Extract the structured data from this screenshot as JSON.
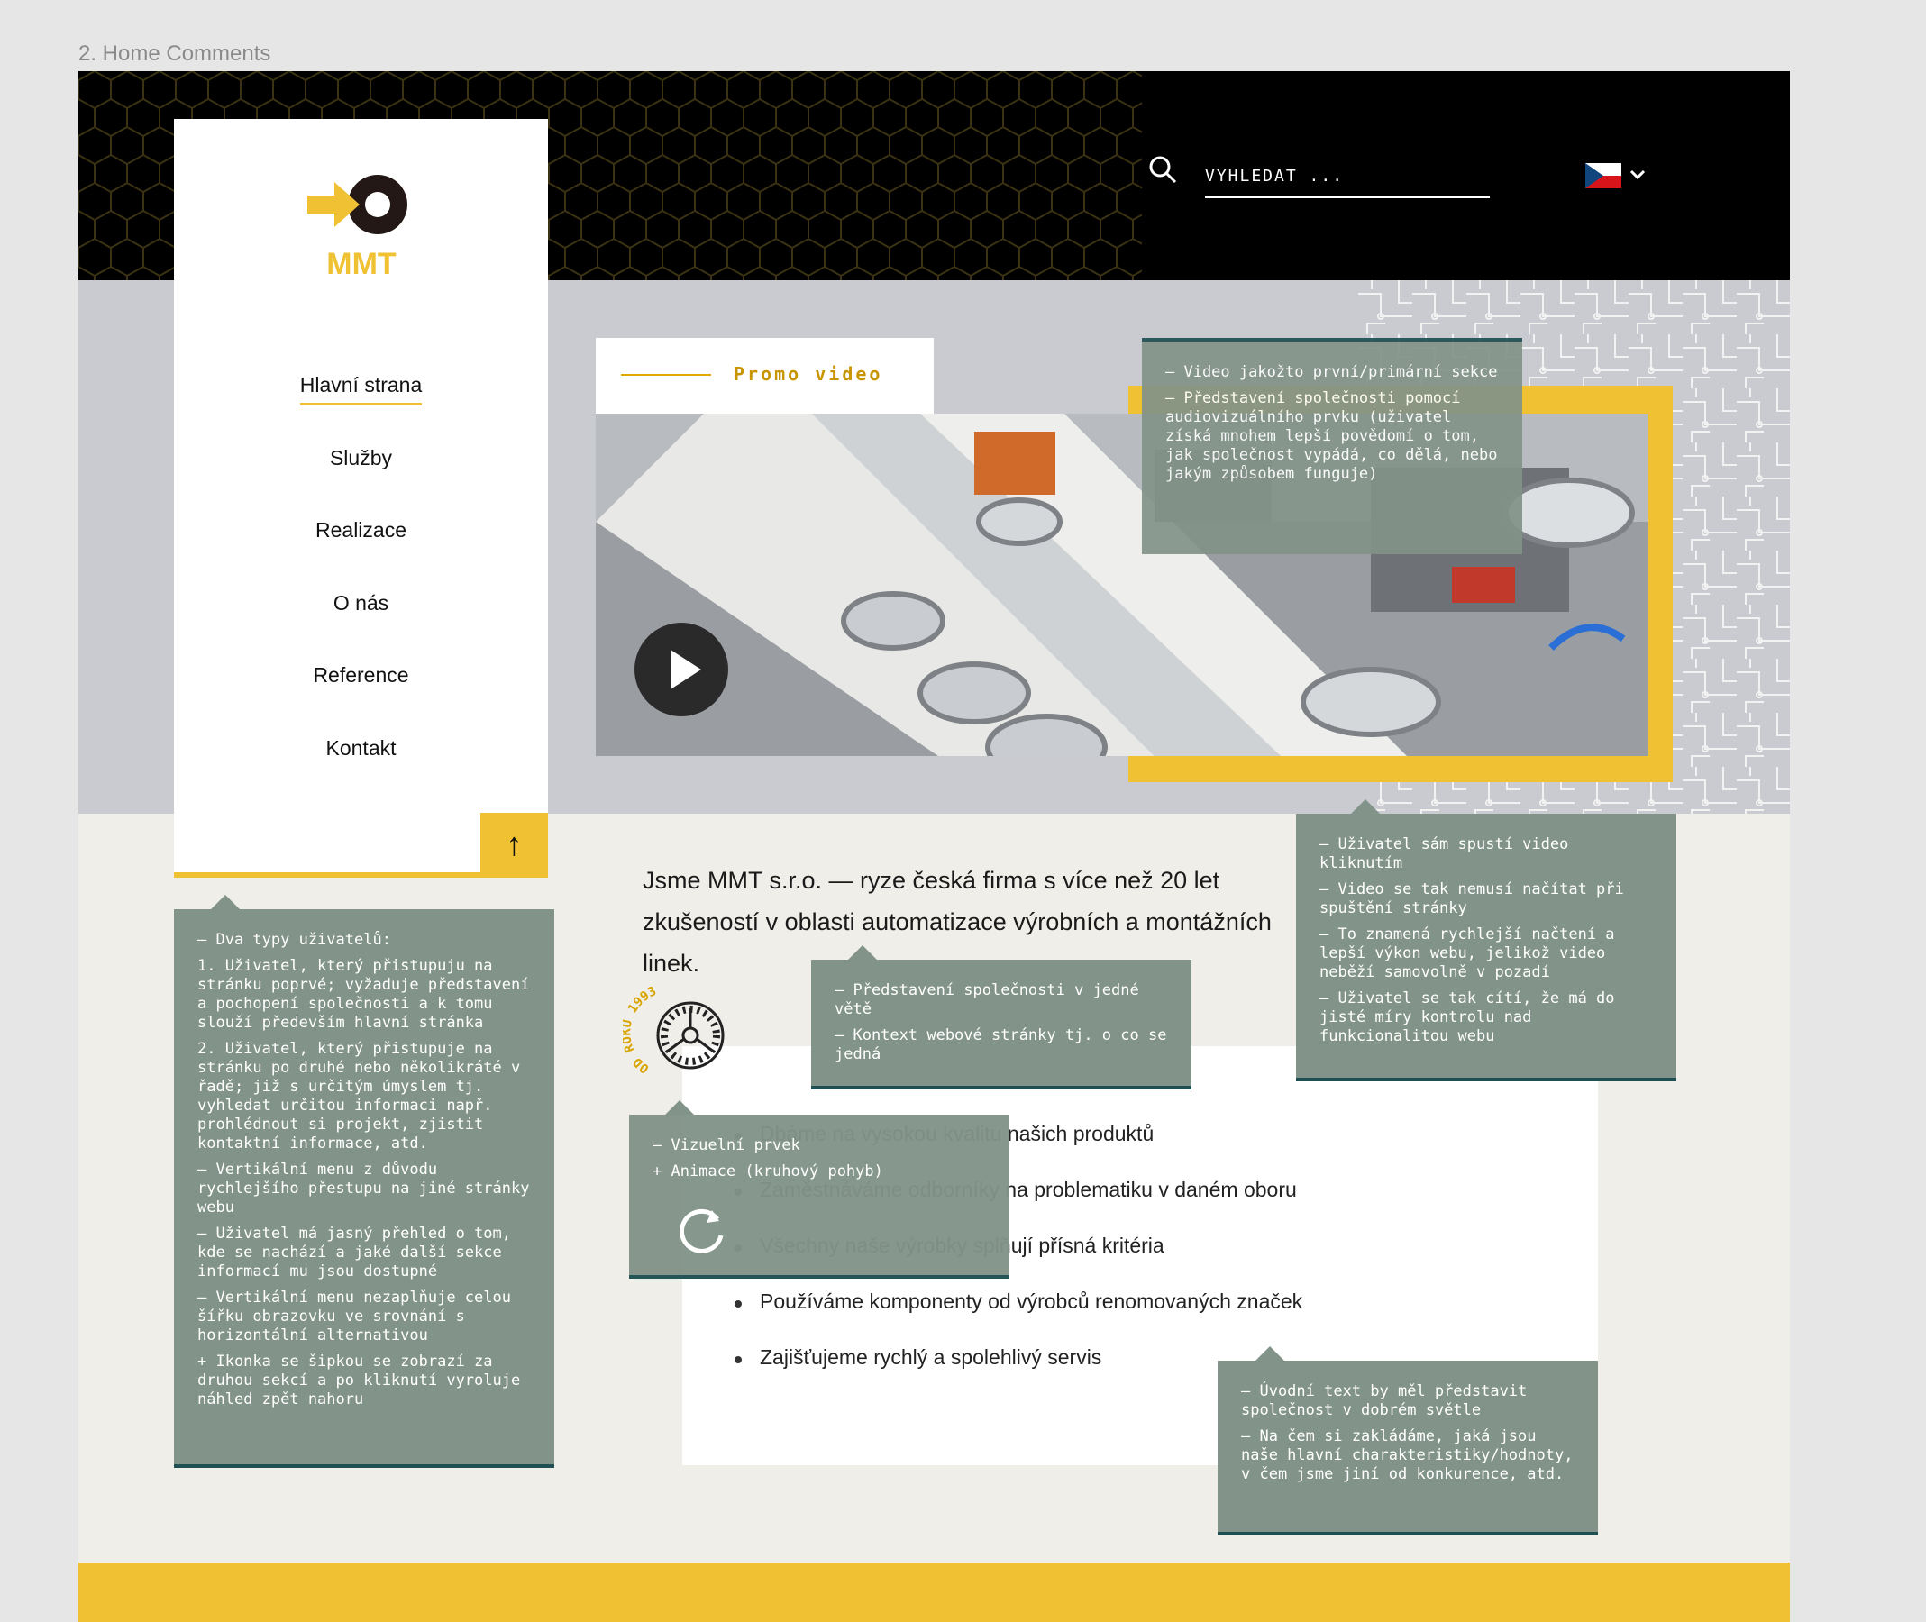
{
  "frame": {
    "label": "2. Home Comments"
  },
  "header": {
    "search_placeholder": "VYHLEDAT ...",
    "language": "cs",
    "language_dropdown_icon": "chevron-down-icon"
  },
  "logo": {
    "text": "MMT"
  },
  "nav": {
    "items": [
      {
        "label": "Hlavní strana",
        "active": true
      },
      {
        "label": "Služby"
      },
      {
        "label": "Realizace"
      },
      {
        "label": "O nás"
      },
      {
        "label": "Reference"
      },
      {
        "label": "Kontakt"
      }
    ],
    "scroll_top_icon": "arrow-up-icon",
    "scroll_top_symbol": "↑"
  },
  "promo": {
    "label": "Promo video",
    "play_icon": "play-icon"
  },
  "intro": {
    "text": "Jsme MMT s.r.o. — ryze česká firma s více než 20 let zkušeností v oblasti automatizace výrobních a montážních linek."
  },
  "badge": {
    "text": "OD ROKU 1993"
  },
  "features": [
    "Dbáme na vysokou kvalitu našich produktů",
    "Zaměstnáváme odborníky na problematiku v daném oboru",
    "Všechny naše výrobky splňují přísná kritéria",
    "Používáme komponenty od výrobců renomovaných značek",
    "Zajišťujeme rychlý a spolehlivý servis"
  ],
  "comments": {
    "video_primary": [
      "– Video jakožto první/primární sekce",
      "– Představení společnosti pomocí audiovizuálního prvku (uživatel získá mnohem lepší povědomí o tom, jak společnost vypádá, co dělá, nebo jakým způsobem funguje)"
    ],
    "video_start": [
      "– Uživatel sám spustí video kliknutím",
      "– Video se tak nemusí načítat při spuštění stránky",
      "– To znamená rychlejší načtení a lepší výkon webu, jelikož video neběží samovolně v pozadí",
      "– Uživatel se tak cítí, že má do jisté míry kontrolu nad funkcionalitou webu"
    ],
    "intro_sentence": [
      "– Představení společnosti v jedné větě",
      "– Kontext webové stránky tj. o co se jedná"
    ],
    "visual": [
      "– Vizuelní prvek",
      "+ Animace (kruhový pohyb)"
    ],
    "visual_icon": "refresh-icon",
    "users": [
      "– Dva typy uživatelů:",
      "1. Uživatel, který přistupuju na stránku poprvé; vyžaduje představení a pochopení společnosti a k tomu slouží především hlavní stránka",
      "2. Uživatel, který přistupuje na stránku po druhé nebo několikráté v řadě; již s určitým úmyslem tj. vyhledat určitou informaci např. prohlédnout si projekt, zjistit kontaktní informace, atd.",
      "– Vertikální menu z důvodu rychlejšího přestupu na jiné stránky webu",
      "– Uživatel má jasný přehled o tom, kde se nachází a jaké další sekce informací mu jsou dostupné",
      "– Vertikální menu nezaplňuje celou šířku obrazovku ve srovnání s horizontální alternativou",
      "+ Ikonka se šipkou se zobrazí za druhou sekcí a po kliknutí vyroluje náhled zpět nahoru"
    ],
    "intro_text": [
      "– Úvodní text by měl představit společnost v dobrém světle",
      "– Na čem si zakládáme, jaká jsou naše hlavní charakteristiky/hodnoty, v čem jsme jiní od konkurence, atd."
    ]
  },
  "colors": {
    "accent": "#f0c233",
    "note": "#829389",
    "note_border": "#1e4f53",
    "header": "#000000"
  }
}
